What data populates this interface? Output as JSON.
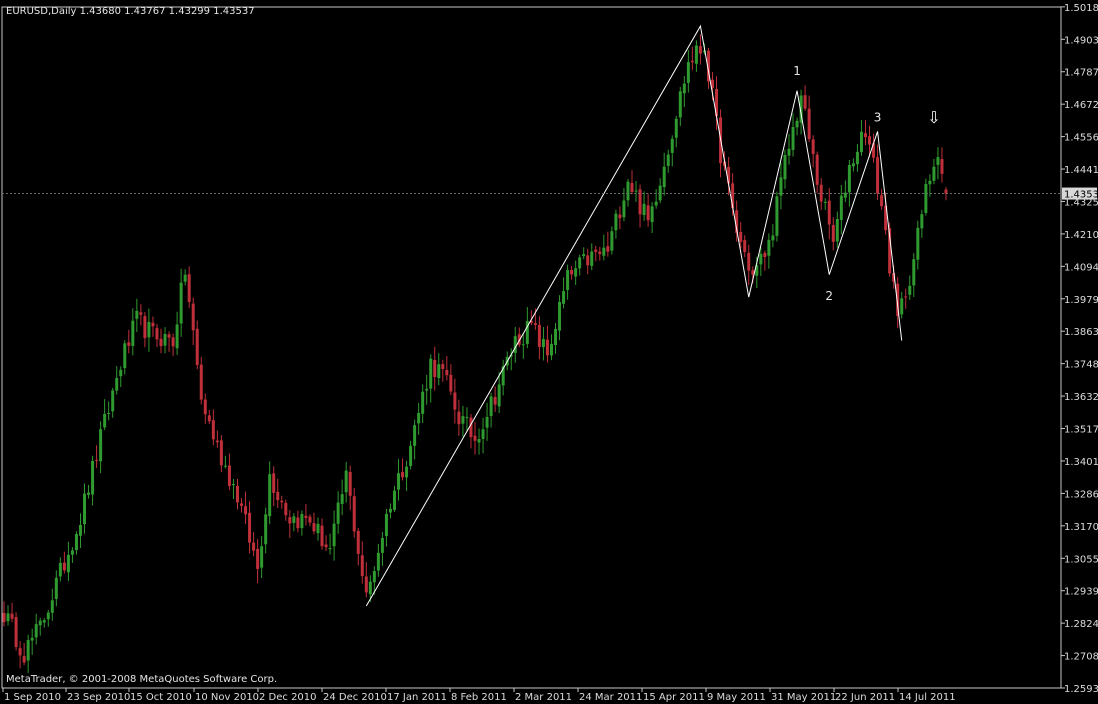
{
  "header": "EURUSD,Daily  1.43680 1.43767 1.43299 1.43537",
  "footer": "MetaTrader, © 2001-2008 MetaQuotes Software Corp.",
  "colors": {
    "background": "#000000",
    "bull": "#2f9a2f",
    "bear": "#c0303a",
    "axis": "#c8c8c8",
    "pattern_line": "#ffffff",
    "current_price_bg": "#d8d8d8"
  },
  "chart_data": {
    "type": "candlestick",
    "symbol": "EURUSD",
    "timeframe": "Daily",
    "last_bar": {
      "open": 1.4368,
      "high": 1.43767,
      "low": 1.43299,
      "close": 1.43537
    },
    "ylim": [
      1.2593,
      1.5018
    ],
    "y_ticks": [
      "1.50185",
      "1.49030",
      "1.47875",
      "1.46720",
      "1.45565",
      "1.44410",
      "1.43255",
      "1.42100",
      "1.40945",
      "1.39790",
      "1.38635",
      "1.37480",
      "1.36325",
      "1.35170",
      "1.34015",
      "1.32860",
      "1.31705",
      "1.30550",
      "1.29395",
      "1.28240",
      "1.27085",
      "1.25930"
    ],
    "current_price_label": "1.43537",
    "x_labels": [
      "1 Sep 2010",
      "23 Sep 2010",
      "15 Oct 2010",
      "10 Nov 2010",
      "2 Dec 2010",
      "24 Dec 2010",
      "17 Jan 2011",
      "8 Feb 2011",
      "2 Mar 2011",
      "24 Mar 2011",
      "15 Apr 2011",
      "9 May 2011",
      "31 May 2011",
      "22 Jun 2011",
      "14 Jul 2011"
    ],
    "bars": 235,
    "anchors": [
      [
        0,
        1.286
      ],
      [
        5,
        1.272
      ],
      [
        9,
        1.281
      ],
      [
        14,
        1.3
      ],
      [
        19,
        1.32
      ],
      [
        24,
        1.348
      ],
      [
        29,
        1.375
      ],
      [
        33,
        1.39
      ],
      [
        37,
        1.385
      ],
      [
        42,
        1.383
      ],
      [
        45,
        1.408
      ],
      [
        49,
        1.362
      ],
      [
        53,
        1.345
      ],
      [
        58,
        1.328
      ],
      [
        63,
        1.302
      ],
      [
        66,
        1.335
      ],
      [
        71,
        1.32
      ],
      [
        76,
        1.319
      ],
      [
        81,
        1.308
      ],
      [
        85,
        1.335
      ],
      [
        90,
        1.291
      ],
      [
        96,
        1.326
      ],
      [
        101,
        1.346
      ],
      [
        106,
        1.375
      ],
      [
        109,
        1.371
      ],
      [
        113,
        1.356
      ],
      [
        117,
        1.348
      ],
      [
        122,
        1.364
      ],
      [
        127,
        1.383
      ],
      [
        131,
        1.388
      ],
      [
        135,
        1.378
      ],
      [
        140,
        1.405
      ],
      [
        145,
        1.412
      ],
      [
        150,
        1.415
      ],
      [
        155,
        1.441
      ],
      [
        160,
        1.425
      ],
      [
        165,
        1.452
      ],
      [
        170,
        1.482
      ],
      [
        174,
        1.488
      ],
      [
        178,
        1.45
      ],
      [
        182,
        1.422
      ],
      [
        186,
        1.406
      ],
      [
        190,
        1.417
      ],
      [
        194,
        1.446
      ],
      [
        198,
        1.47
      ],
      [
        202,
        1.44
      ],
      [
        206,
        1.418
      ],
      [
        210,
        1.445
      ],
      [
        214,
        1.459
      ],
      [
        218,
        1.431
      ],
      [
        222,
        1.39
      ],
      [
        226,
        1.412
      ],
      [
        229,
        1.436
      ],
      [
        232,
        1.452
      ],
      [
        234,
        1.435
      ]
    ],
    "pattern_points": [
      [
        90,
        1.2885
      ],
      [
        173,
        1.495
      ],
      [
        185,
        1.3985
      ],
      [
        197,
        1.472
      ],
      [
        205,
        1.4065
      ],
      [
        217,
        1.4575
      ],
      [
        223,
        1.383
      ]
    ],
    "pattern_labels": [
      {
        "text": "1",
        "bar": 197,
        "price": 1.4775
      },
      {
        "text": "2",
        "bar": 205,
        "price": 1.3975
      },
      {
        "text": "3",
        "bar": 217,
        "price": 1.461
      }
    ],
    "signal_arrow": {
      "bar": 231,
      "price": 1.4605,
      "label": "⇩"
    }
  }
}
